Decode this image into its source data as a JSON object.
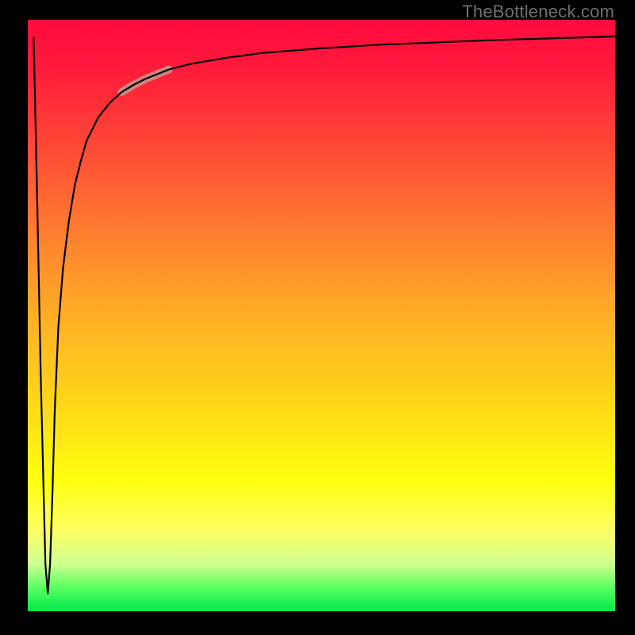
{
  "watermark": "TheBottleneck.com",
  "colors": {
    "gradient_top": "#ff0a3e",
    "gradient_bottom": "#00e84a",
    "curve": "#000000",
    "highlight": "#c98b83",
    "frame": "#000000"
  },
  "chart_data": {
    "type": "line",
    "title": "",
    "xlabel": "",
    "ylabel": "",
    "xlim": [
      0,
      100
    ],
    "ylim": [
      0,
      100
    ],
    "grid": false,
    "legend": false,
    "annotations": [],
    "series": [
      {
        "name": "bottleneck-curve",
        "x": [
          1.0,
          1.6,
          2.2,
          3.0,
          3.4,
          3.8,
          4.2,
          4.6,
          5.2,
          6.0,
          7.0,
          8.0,
          9.0,
          10.0,
          12.0,
          14.0,
          16.0,
          18.0,
          20.0,
          24.0,
          28.0,
          34.0,
          40.0,
          50.0,
          60.0,
          70.0,
          80.0,
          90.0,
          100.0
        ],
        "y": [
          97.0,
          70.0,
          40.0,
          8.0,
          3.0,
          8.0,
          20.0,
          34.0,
          48.0,
          58.0,
          66.0,
          72.0,
          76.0,
          79.5,
          83.5,
          86.0,
          87.8,
          89.0,
          90.0,
          91.6,
          92.6,
          93.6,
          94.4,
          95.2,
          95.8,
          96.2,
          96.6,
          96.9,
          97.2
        ]
      }
    ],
    "highlight_segment": {
      "x_start": 16.0,
      "x_end": 24.0
    }
  }
}
